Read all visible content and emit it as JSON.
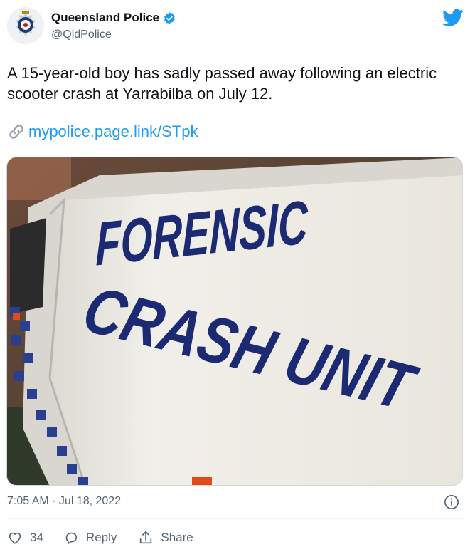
{
  "account": {
    "display_name": "Queensland Police",
    "handle": "@QldPolice",
    "verified": true,
    "avatar_icon": "queensland-police-badge"
  },
  "tweet": {
    "text": "A 15-year-old boy has sadly passed away following an electric scooter crash at Yarrabilba on July 12.",
    "link_text": "mypolice.page.link/STpk",
    "link_icon": "link-icon",
    "photo_text": [
      "FORENSIC",
      "CRASH UNIT"
    ],
    "timestamp": "7:05 AM · Jul 18, 2022"
  },
  "actions": {
    "like_count": "34",
    "reply_label": "Reply",
    "share_label": "Share"
  },
  "colors": {
    "link": "#1d9bf0",
    "verified": "#1d9bf0",
    "secondary_text": "#536471",
    "photo_lettering": "#1b2a72"
  }
}
